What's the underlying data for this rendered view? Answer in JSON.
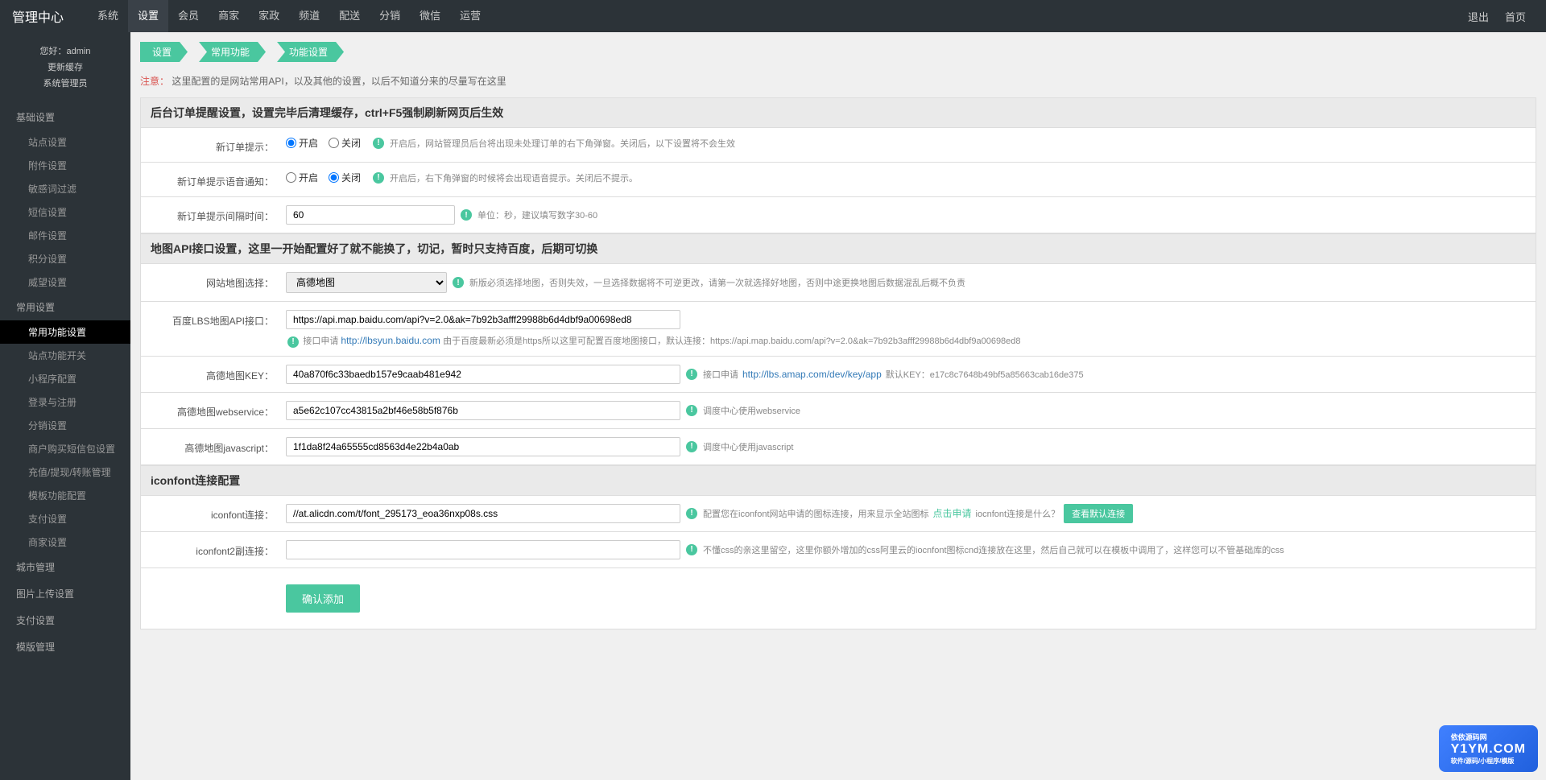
{
  "header": {
    "title": "管理中心",
    "nav": [
      "系统",
      "设置",
      "会员",
      "商家",
      "家政",
      "频道",
      "配送",
      "分销",
      "微信",
      "运营"
    ],
    "right": [
      "退出",
      "首页"
    ]
  },
  "sidebar": {
    "user": {
      "greeting": "您好：admin",
      "cache": "更新缓存",
      "role": "系统管理员"
    },
    "groups": [
      {
        "label": "基础设置",
        "items": [
          "站点设置",
          "附件设置",
          "敏感词过滤",
          "短信设置",
          "邮件设置",
          "积分设置",
          "威望设置"
        ]
      },
      {
        "label": "常用设置",
        "items": [
          "常用功能设置",
          "站点功能开关",
          "小程序配置",
          "登录与注册",
          "分销设置",
          "商户购买短信包设置",
          "充值/提现/转账管理",
          "模板功能配置",
          "支付设置",
          "商家设置"
        ]
      },
      {
        "label": "城市管理",
        "items": []
      },
      {
        "label": "图片上传设置",
        "items": []
      },
      {
        "label": "支付设置",
        "items": []
      },
      {
        "label": "模版管理",
        "items": []
      }
    ]
  },
  "breadcrumb": [
    "设置",
    "常用功能",
    "功能设置"
  ],
  "notice": {
    "label": "注意：",
    "text": "这里配置的是网站常用API，以及其他的设置，以后不知道分来的尽量写在这里"
  },
  "sections": {
    "s1": {
      "title": "后台订单提醒设置，设置完毕后清理缓存，ctrl+F5强制刷新网页后生效",
      "rows": {
        "r1": {
          "label": "新订单提示：",
          "opt1": "开启",
          "opt2": "关闭",
          "help": "开启后，网站管理员后台将出现未处理订单的右下角弹窗。关闭后，以下设置将不会生效"
        },
        "r2": {
          "label": "新订单提示语音通知：",
          "opt1": "开启",
          "opt2": "关闭",
          "help": "开启后，右下角弹窗的时候将会出现语音提示。关闭后不提示。"
        },
        "r3": {
          "label": "新订单提示间隔时间：",
          "value": "60",
          "help": "单位：秒，建议填写数字30-60"
        }
      }
    },
    "s2": {
      "title": "地图API接口设置，这里一开始配置好了就不能换了，切记，暂时只支持百度，后期可切换",
      "rows": {
        "r1": {
          "label": "网站地图选择：",
          "opt": "高德地图",
          "help": "新版必须选择地图，否则失效，一旦选择数据将不可逆更改，请第一次就选择好地图，否则中途更换地图后数据混乱后概不负责"
        },
        "r2": {
          "label": "百度LBS地图API接口：",
          "value": "https://api.map.baidu.com/api?v=2.0&ak=7b92b3afff29988b6d4dbf9a00698ed8",
          "help1": "接口申请 ",
          "link": "http://lbsyun.baidu.com",
          "help2": " 由于百度最新必须是https所以这里可配置百度地图接口，默认连接：https://api.map.baidu.com/api?v=2.0&ak=7b92b3afff29988b6d4dbf9a00698ed8"
        },
        "r3": {
          "label": "高德地图KEY：",
          "value": "40a870f6c33baedb157e9caab481e942",
          "help1": "接口申请 ",
          "link": "http://lbs.amap.com/dev/key/app",
          "help2": " 默认KEY：e17c8c7648b49bf5a85663cab16de375"
        },
        "r4": {
          "label": "高德地图webservice：",
          "value": "a5e62c107cc43815a2bf46e58b5f876b",
          "help": "调度中心使用webservice"
        },
        "r5": {
          "label": "高德地图javascript：",
          "value": "1f1da8f24a65555cd8563d4e22b4a0ab",
          "help": "调度中心使用javascript"
        }
      }
    },
    "s3": {
      "title": "iconfont连接配置",
      "rows": {
        "r1": {
          "label": "iconfont连接：",
          "value": "//at.alicdn.com/t/font_295173_eoa36nxp08s.css",
          "help1": "配置您在iconfont网站申请的图标连接，用来显示全站图标 ",
          "link1": "点击申请",
          "help2": " iocnfont连接是什么？",
          "btn": "查看默认连接"
        },
        "r2": {
          "label": "iconfont2副连接：",
          "value": "",
          "help": "不懂css的亲这里留空，这里你额外增加的css阿里云的iocnfont图标cnd连接放在这里，然后自己就可以在模板中调用了，这样您可以不管基础库的css"
        }
      }
    }
  },
  "submit": "确认添加",
  "watermark": {
    "top": "依依源码网",
    "main": "Y1YM.COM",
    "sub": "软件/源码/小程序/模版"
  }
}
